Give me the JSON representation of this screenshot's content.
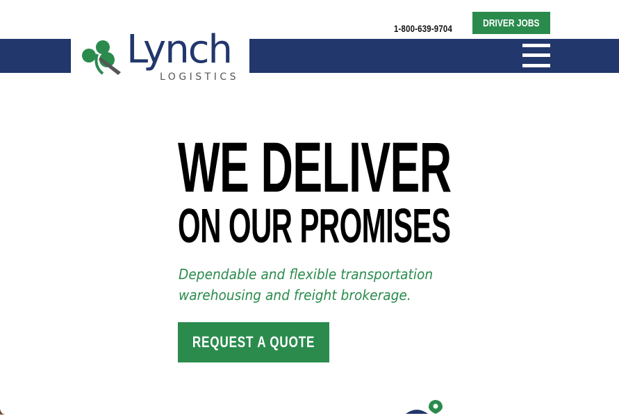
{
  "header": {
    "phone": "1-800-639-9704",
    "driver_jobs_label": "DRIVER JOBS"
  },
  "logo": {
    "name": "Lynch",
    "subtitle": "LOGISTICS"
  },
  "hero": {
    "title": "WE DELIVER",
    "subtitle": "ON OUR PROMISES",
    "tagline_line1": "Dependable and flexible transportation",
    "tagline_line2": "warehousing and freight brokerage.",
    "cta_label": "REQUEST A QUOTE"
  },
  "colors": {
    "brand_navy": "#22376b",
    "brand_green": "#2a8b4d"
  },
  "icons": [
    "clover-icon",
    "hamburger-menu-icon",
    "map-pin-icon"
  ]
}
